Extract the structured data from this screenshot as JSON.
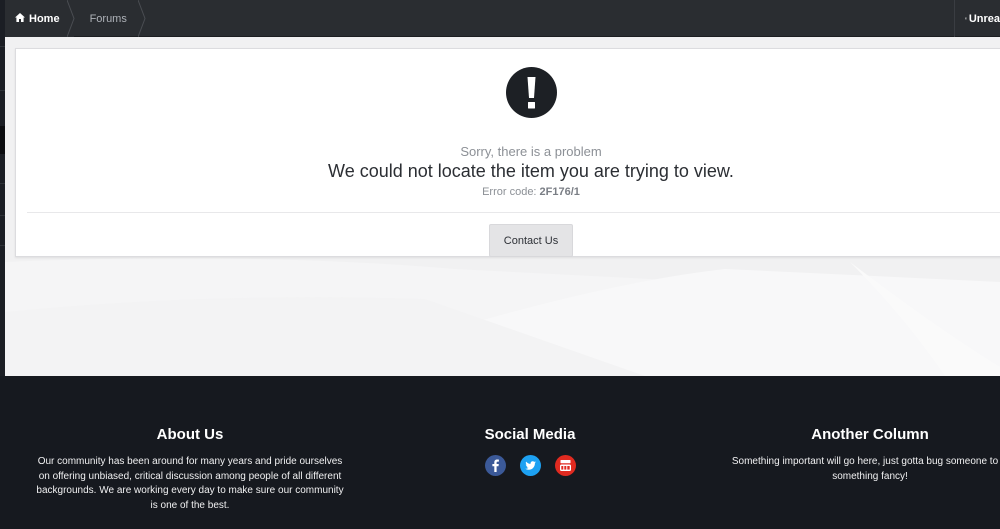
{
  "nav": {
    "breadcrumbs": [
      {
        "label": "Home",
        "icon": "home-icon"
      },
      {
        "label": "Forums"
      }
    ],
    "unread_label": "Unrea"
  },
  "error": {
    "subtitle": "Sorry, there is a problem",
    "title": "We could not locate the item you are trying to view.",
    "code_prefix": "Error code: ",
    "code": "2F176/1",
    "contact_label": "Contact Us"
  },
  "footer": {
    "about": {
      "title": "About Us",
      "text": "Our community has been around for many years and pride ourselves on offering unbiased, critical discussion among people of all different backgrounds. We are working every day to make sure our community is one of the best."
    },
    "social": {
      "title": "Social Media",
      "icons": [
        "facebook-icon",
        "twitter-icon",
        "youtube-icon"
      ]
    },
    "another": {
      "title": "Another Column",
      "text": "Something important will go here, just gotta bug someone to w something fancy!"
    }
  },
  "colors": {
    "nav_bg": "#2a2d31",
    "footer_bg": "#16191f",
    "facebook": "#3b5998",
    "twitter": "#1da1f2",
    "youtube": "#e02a20"
  }
}
